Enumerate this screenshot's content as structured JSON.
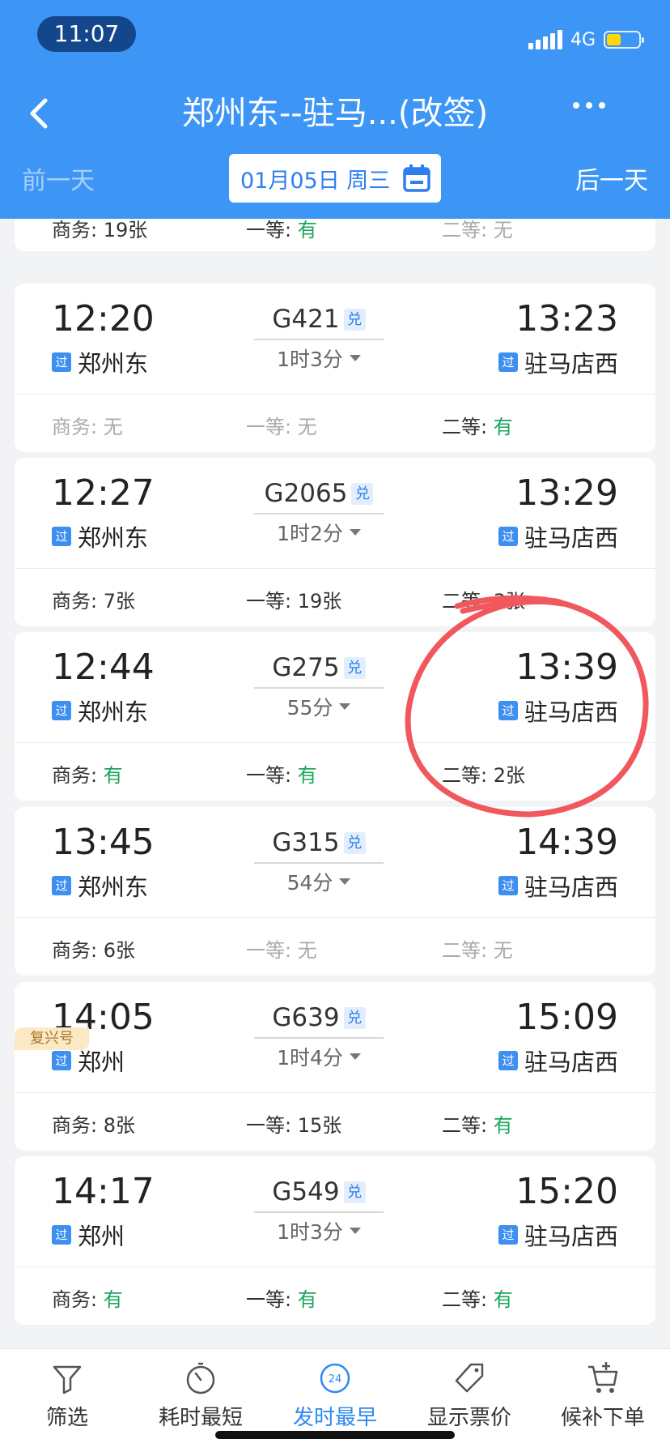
{
  "status_bar": {
    "time": "11:07",
    "network": "4G",
    "battery_level": 0.45,
    "battery_color": "#ffd60a"
  },
  "header": {
    "title": "郑州东--驻马...(改签)",
    "back_icon": "chevron-left-icon",
    "more_icon": "more-dots-icon",
    "prev_day": "前一天",
    "next_day": "后一天",
    "date": "01月05日 周三",
    "calendar_icon": "calendar-icon",
    "bg_color": "#3d96f5"
  },
  "partial_train": {
    "seats": [
      {
        "label": "商务: ",
        "value": "19张",
        "state": "count"
      },
      {
        "label": "一等: ",
        "value": "有",
        "state": "avail"
      },
      {
        "label": "二等: ",
        "value": "无",
        "state": "none"
      }
    ]
  },
  "trains": [
    {
      "dep_time": "12:20",
      "dep_station": "郑州东",
      "dep_badge": "过",
      "train_no": "G421",
      "badge": "兑",
      "duration": "1时3分",
      "arr_time": "13:23",
      "arr_station": "驻马店西",
      "arr_badge": "过",
      "seats": [
        {
          "label": "商务: ",
          "value": "无",
          "state": "none"
        },
        {
          "label": "一等: ",
          "value": "无",
          "state": "none"
        },
        {
          "label": "二等: ",
          "value": "有",
          "state": "avail"
        }
      ]
    },
    {
      "dep_time": "12:27",
      "dep_station": "郑州东",
      "dep_badge": "过",
      "train_no": "G2065",
      "badge": "兑",
      "duration": "1时2分",
      "arr_time": "13:29",
      "arr_station": "驻马店西",
      "arr_badge": "过",
      "seats": [
        {
          "label": "商务: ",
          "value": "7张",
          "state": "count"
        },
        {
          "label": "一等: ",
          "value": "19张",
          "state": "count"
        },
        {
          "label": "二等: ",
          "value": "3张",
          "state": "count"
        }
      ]
    },
    {
      "dep_time": "12:44",
      "dep_station": "郑州东",
      "dep_badge": "过",
      "train_no": "G275",
      "badge": "兑",
      "duration": "55分",
      "arr_time": "13:39",
      "arr_station": "驻马店西",
      "arr_badge": "过",
      "seats": [
        {
          "label": "商务: ",
          "value": "有",
          "state": "avail"
        },
        {
          "label": "一等: ",
          "value": "有",
          "state": "avail"
        },
        {
          "label": "二等: ",
          "value": "2张",
          "state": "count"
        }
      ]
    },
    {
      "tag": "复兴号",
      "dep_time": "13:45",
      "dep_station": "郑州东",
      "dep_badge": "过",
      "train_no": "G315",
      "badge": "兑",
      "duration": "54分",
      "arr_time": "14:39",
      "arr_station": "驻马店西",
      "arr_badge": "过",
      "seats": [
        {
          "label": "商务: ",
          "value": "6张",
          "state": "count"
        },
        {
          "label": "一等: ",
          "value": "无",
          "state": "none"
        },
        {
          "label": "二等: ",
          "value": "无",
          "state": "none"
        }
      ]
    },
    {
      "dep_time": "14:05",
      "dep_station": "郑州",
      "dep_badge": "过",
      "train_no": "G639",
      "badge": "兑",
      "duration": "1时4分",
      "arr_time": "15:09",
      "arr_station": "驻马店西",
      "arr_badge": "过",
      "seats": [
        {
          "label": "商务: ",
          "value": "8张",
          "state": "count"
        },
        {
          "label": "一等: ",
          "value": "15张",
          "state": "count"
        },
        {
          "label": "二等: ",
          "value": "有",
          "state": "avail"
        }
      ]
    },
    {
      "dep_time": "14:17",
      "dep_station": "郑州",
      "dep_badge": "过",
      "train_no": "G549",
      "badge": "兑",
      "duration": "1时3分",
      "arr_time": "15:20",
      "arr_station": "驻马店西",
      "arr_badge": "过",
      "seats": [
        {
          "label": "商务: ",
          "value": "有",
          "state": "avail"
        },
        {
          "label": "一等: ",
          "value": "有",
          "state": "avail"
        },
        {
          "label": "二等: ",
          "value": "有",
          "state": "avail"
        }
      ]
    }
  ],
  "colors": {
    "available": "#18a65b",
    "unavailable": "#aaaaaa",
    "annotation_circle": "#f0585e"
  },
  "tabbar": {
    "tabs": [
      {
        "label": "筛选",
        "icon": "filter-icon",
        "active": false
      },
      {
        "label": "耗时最短",
        "icon": "stopwatch-icon",
        "active": false
      },
      {
        "label": "发时最早",
        "icon": "clock-24-icon",
        "active": true,
        "icon_text": "24"
      },
      {
        "label": "显示票价",
        "icon": "price-tag-icon",
        "active": false
      },
      {
        "label": "候补下单",
        "icon": "cart-add-icon",
        "active": false
      }
    ]
  }
}
